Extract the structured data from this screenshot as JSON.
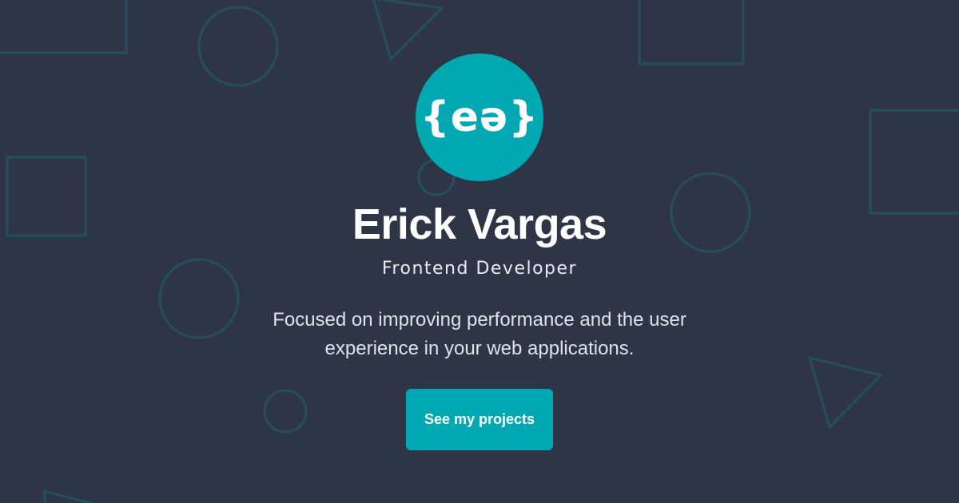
{
  "logo": {
    "text": "{eə}"
  },
  "hero": {
    "name": "Erick Vargas",
    "role": "Frontend Developer",
    "description": "Focused on improving performance and the user experience in your web applications.",
    "cta_label": "See my projects"
  },
  "colors": {
    "background": "#2e3547",
    "accent": "#00a9b1",
    "shape_outline": "#24505a"
  }
}
